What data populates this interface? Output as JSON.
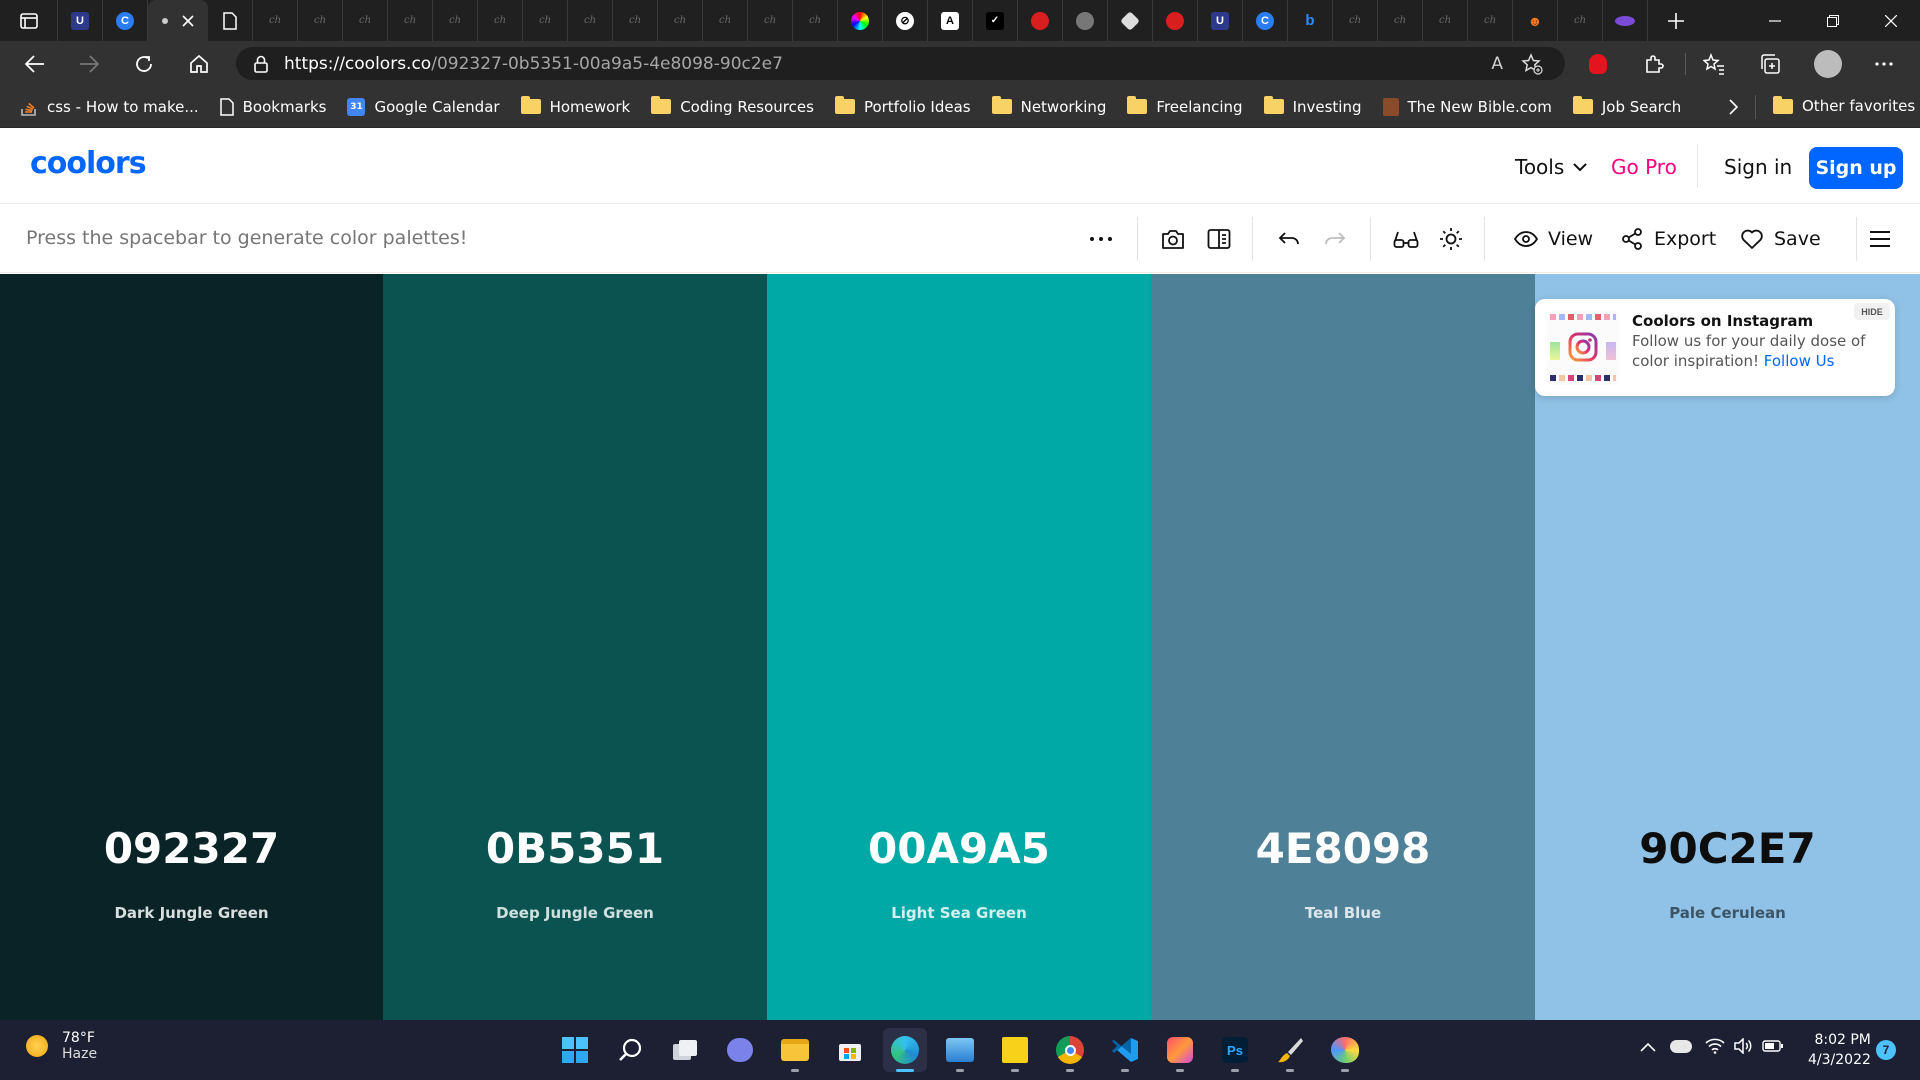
{
  "browser": {
    "url_host": "https://coolors.co",
    "url_path": "/092327-0b5351-00a9a5-4e8098-90c2e7",
    "tab_ch_label": "ch",
    "bookmarks": [
      {
        "label": "css - How to make...",
        "icon": "stackoverflow-icon"
      },
      {
        "label": "Bookmarks",
        "icon": "page-icon"
      },
      {
        "label": "Google Calendar",
        "icon": "calendar-icon",
        "badge": "31"
      },
      {
        "label": "Homework",
        "icon": "folder-icon"
      },
      {
        "label": "Coding Resources",
        "icon": "folder-icon"
      },
      {
        "label": "Portfolio Ideas",
        "icon": "folder-icon"
      },
      {
        "label": "Networking",
        "icon": "folder-icon"
      },
      {
        "label": "Freelancing",
        "icon": "folder-icon"
      },
      {
        "label": "Investing",
        "icon": "folder-icon"
      },
      {
        "label": "The New Bible.com",
        "icon": "bible-icon"
      },
      {
        "label": "Job Search",
        "icon": "folder-icon"
      }
    ],
    "other_favorites": "Other favorites",
    "read_aloud_glyph": "A"
  },
  "site": {
    "logo": "coolors",
    "nav": {
      "tools": "Tools",
      "go_pro": "Go Pro",
      "sign_in": "Sign in",
      "sign_up": "Sign up"
    },
    "hint": "Press the spacebar to generate color palettes!",
    "toolbar": {
      "view": "View",
      "export": "Export",
      "save": "Save"
    }
  },
  "palette": [
    {
      "hex": "092327",
      "name": "Dark Jungle Green",
      "color": "#092327",
      "text_color": "#ffffff",
      "name_color": "#d9dede"
    },
    {
      "hex": "0B5351",
      "name": "Deep Jungle Green",
      "color": "#0b5351",
      "text_color": "#ffffff",
      "name_color": "#cfe0df"
    },
    {
      "hex": "00A9A5",
      "name": "Light Sea Green",
      "color": "#00a9a5",
      "text_color": "#ffffff",
      "name_color": "#d4f1f0"
    },
    {
      "hex": "4E8098",
      "name": "Teal Blue",
      "color": "#4e8098",
      "text_color": "#ffffff",
      "name_color": "#dbe6eb"
    },
    {
      "hex": "90C2E7",
      "name": "Pale Cerulean",
      "color": "#90c2e7",
      "text_color": "#0d0d0d",
      "name_color": "#3c5566"
    }
  ],
  "promo": {
    "title": "Coolors on Instagram",
    "text": "Follow us for your daily dose of color inspiration!",
    "link": "Follow Us",
    "hide": "HIDE"
  },
  "taskbar": {
    "temperature": "78°F",
    "condition": "Haze",
    "time": "8:02 PM",
    "date": "4/3/2022",
    "notifications": "7"
  },
  "colors": {
    "brand": "#0066ff",
    "pro": "#ff0080",
    "browser_dark": "#202020",
    "browser_bar": "#323232"
  }
}
